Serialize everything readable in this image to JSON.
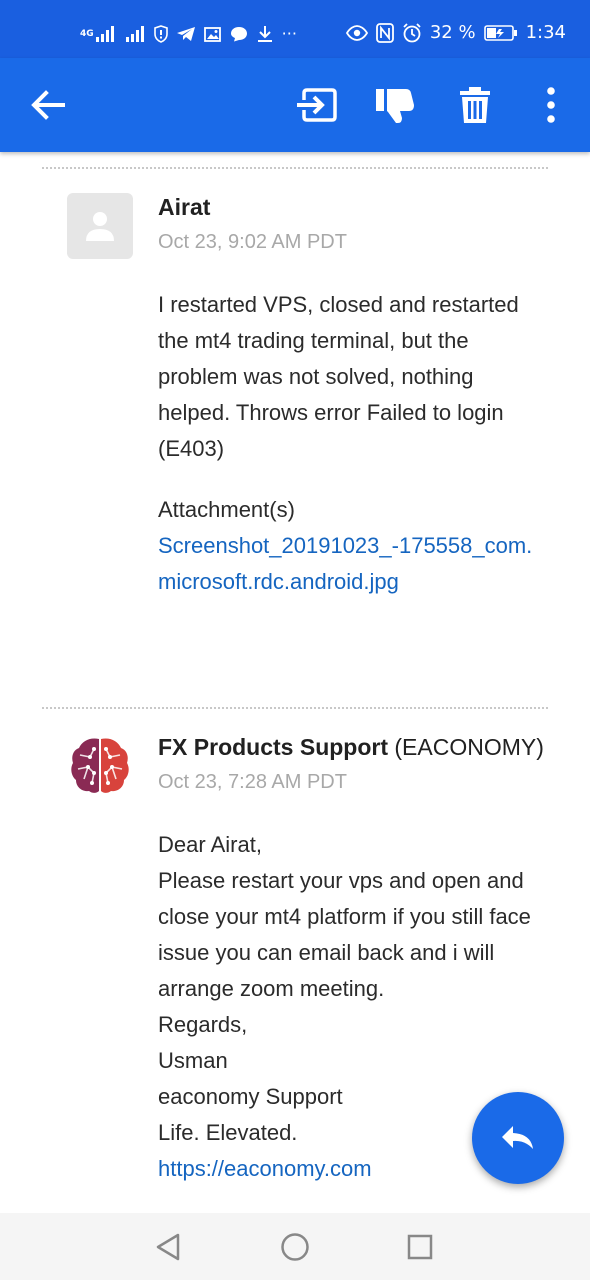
{
  "status_bar": {
    "network_type": "4G",
    "battery_percent": "32 %",
    "time": "1:34",
    "more": "···"
  },
  "app_bar": {
    "icons": [
      "arrow-back-icon",
      "move-to-icon",
      "thumbs-down-icon",
      "delete-icon",
      "more-vert-icon"
    ]
  },
  "messages": [
    {
      "sender": "Airat",
      "org": "",
      "date": "Oct 23, 9:02 AM PDT",
      "body": [
        "I restarted VPS, closed and restarted the mt4 trading terminal, but the problem was not solved, nothing helped. Throws error Failed to login (E403)"
      ],
      "attachment_label": "Attachment(s)",
      "attachment_name": "Screenshot_20191023_-175558_com.microsoft.rdc.android.jpg"
    },
    {
      "sender": "FX Products Support",
      "org": " (EACONOMY)",
      "date": "Oct 23, 7:28 AM PDT",
      "body": [
        "Dear Airat,",
        "Please restart your vps and open and close your mt4 platform if you still face issue you can email back and i will arrange zoom meeting.",
        "Regards,",
        "Usman",
        "eaconomy Support",
        "Life. Elevated."
      ],
      "link": "https://eaconomy.com"
    }
  ],
  "colors": {
    "status_bar": "#1a5fe0",
    "app_bar": "#1a6ae8",
    "link": "#1565c0",
    "date": "#a8a8a8"
  }
}
